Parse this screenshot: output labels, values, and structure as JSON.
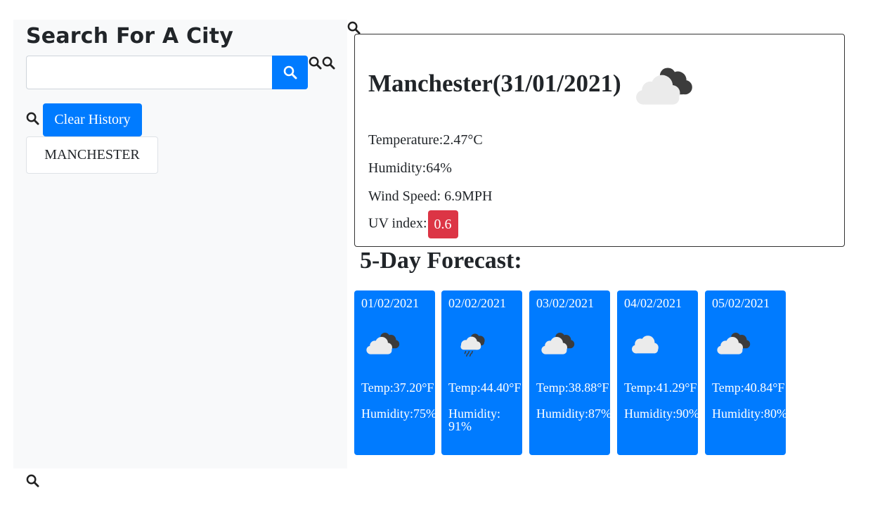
{
  "sidebar": {
    "title": "Search For A City",
    "search_value": "",
    "search_placeholder": "",
    "clear_label": "Clear History",
    "history": [
      "MANCHESTER"
    ]
  },
  "current": {
    "title": "Manchester(31/01/2021)",
    "temperature": "Temperature:2.47°C",
    "humidity": "Humidity:64%",
    "wind": "Wind Speed: 6.9MPH",
    "uv_label": "UV index:",
    "uv_value": "0.6",
    "icon": "cloud-icon"
  },
  "forecast": {
    "title": "5-Day Forecast:",
    "days": [
      {
        "date": "01/02/2021",
        "icon": "cloud-icon",
        "temp": "Temp:37.20°F",
        "humidity": "Humidity:75%"
      },
      {
        "date": "02/02/2021",
        "icon": "rain-cloud-icon",
        "temp": "Temp:44.40°F",
        "humidity": "Humidity: 91%"
      },
      {
        "date": "03/02/2021",
        "icon": "cloud-icon",
        "temp": "Temp:38.88°F",
        "humidity": "Humidity:87%"
      },
      {
        "date": "04/02/2021",
        "icon": "light-cloud-icon",
        "temp": "Temp:41.29°F",
        "humidity": "Humidity:90%"
      },
      {
        "date": "05/02/2021",
        "icon": "cloud-icon",
        "temp": "Temp:40.84°F",
        "humidity": "Humidity:80%"
      }
    ]
  },
  "colors": {
    "primary": "#007bff",
    "danger": "#dc3545",
    "sidebar_bg": "#f8f9fa"
  }
}
